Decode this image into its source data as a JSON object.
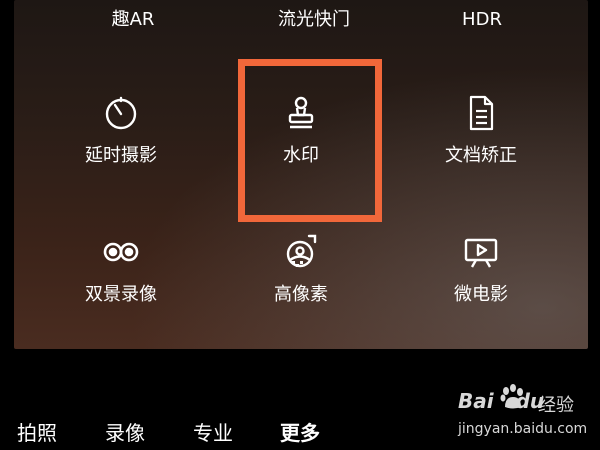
{
  "top_row": [
    "趣AR",
    "流光快门",
    "HDR"
  ],
  "grid": [
    {
      "label": "延时摄影",
      "icon": "timer-icon"
    },
    {
      "label": "水印",
      "icon": "stamp-icon"
    },
    {
      "label": "文档矫正",
      "icon": "document-icon"
    },
    {
      "label": "双景录像",
      "icon": "dual-view-icon"
    },
    {
      "label": "高像素",
      "icon": "high-pixel-icon"
    },
    {
      "label": "微电影",
      "icon": "micro-movie-icon"
    }
  ],
  "highlight_color": "#f1673a",
  "modes": [
    {
      "label": "拍照",
      "active": false
    },
    {
      "label": "录像",
      "active": false
    },
    {
      "label": "专业",
      "active": false
    },
    {
      "label": "更多",
      "active": true
    }
  ],
  "watermark": {
    "brand": "Bai",
    "brand_du": "du",
    "cn": "经验",
    "url": "jingyan.baidu.com"
  }
}
